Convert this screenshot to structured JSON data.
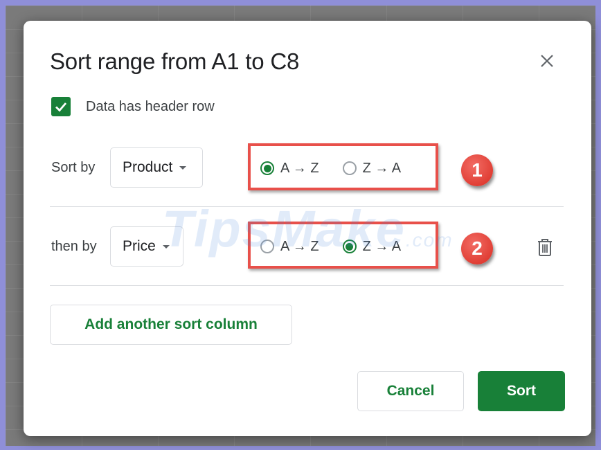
{
  "dialog": {
    "title": "Sort range from A1 to C8",
    "close_icon": "close-icon",
    "header_row": {
      "label": "Data has header row",
      "checked": true
    }
  },
  "sort_rows": [
    {
      "label": "Sort by",
      "column": "Product",
      "options": [
        "A → Z",
        "Z → A"
      ],
      "selected": "A → Z",
      "badge": "1"
    },
    {
      "label": "then by",
      "column": "Price",
      "options": [
        "A → Z",
        "Z → A"
      ],
      "selected": "Z → A",
      "badge": "2",
      "delete_icon": "trash-icon"
    }
  ],
  "actions": {
    "add_sort_column": "Add another sort column",
    "cancel": "Cancel",
    "sort": "Sort"
  },
  "watermark": {
    "main": "TipsMake",
    "suffix": ".com"
  },
  "colors": {
    "accent": "#188038",
    "highlight": "#e8504a",
    "badge": "#d92c22",
    "background": "#8f8fd8"
  }
}
